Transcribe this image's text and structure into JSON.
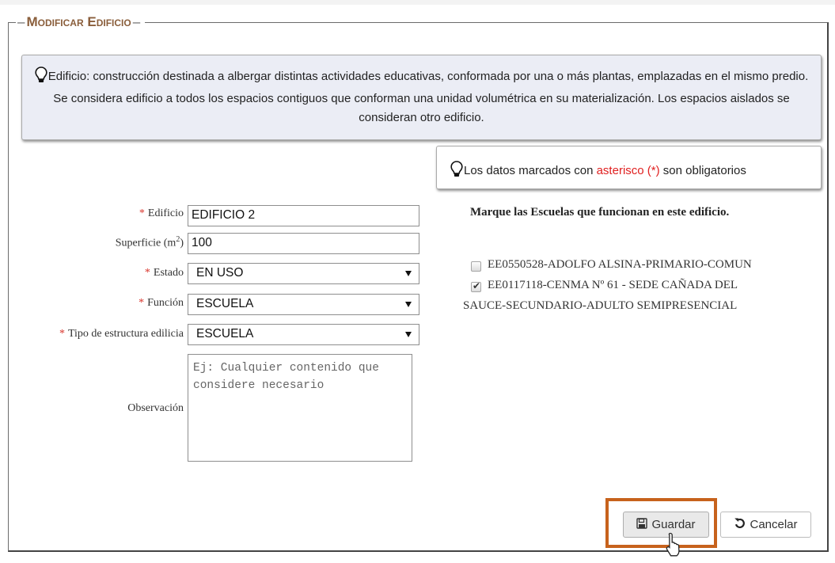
{
  "legend": {
    "title": "Modificar Edificio"
  },
  "info": {
    "term": "Edificio",
    "text": ": construcción destinada a albergar distintas actividades educativas, conformada por una o más plantas, emplazadas en el mismo predio. Se considera edificio a todos los espacios contiguos que conforman una unidad volumétrica en su materialización. Los espacios aislados se consideran otro edificio."
  },
  "required_note": {
    "before": "Los datos marcados con ",
    "highlight": "asterisco (*)",
    "after": " son obligatorios"
  },
  "form": {
    "asterisk": "*",
    "edificio": {
      "label": "Edificio",
      "value": "EDIFICIO 2"
    },
    "superficie": {
      "label": "Superficie (m",
      "sup": "2",
      "label_end": ")",
      "value": "100"
    },
    "estado": {
      "label": "Estado",
      "value": "EN USO"
    },
    "funcion": {
      "label": "Función",
      "value": "ESCUELA"
    },
    "tipo": {
      "label": "Tipo de estructura edilicia",
      "value": "ESCUELA"
    },
    "observacion": {
      "label": "Observación",
      "placeholder": "Ej: Cualquier contenido que considere necesario"
    }
  },
  "schools": {
    "title": "Marque las Escuelas que funcionan en este edificio.",
    "items": [
      {
        "line1": "EE0550528-ADOLFO ALSINA-PRIMARIO-COMUN",
        "checked": false
      },
      {
        "line1": "EE0117118-CENMA Nº 61 - SEDE CAÑADA DEL",
        "line2": "SAUCE-SECUNDARIO-ADULTO SEMIPRESENCIAL",
        "checked": true
      }
    ]
  },
  "actions": {
    "save": "Guardar",
    "cancel": "Cancelar"
  },
  "colors": {
    "legend": "#8a5e3b",
    "required": "#d9342b",
    "highlight_frame": "#c7621c",
    "infobox_bg": "#ebedf5"
  }
}
